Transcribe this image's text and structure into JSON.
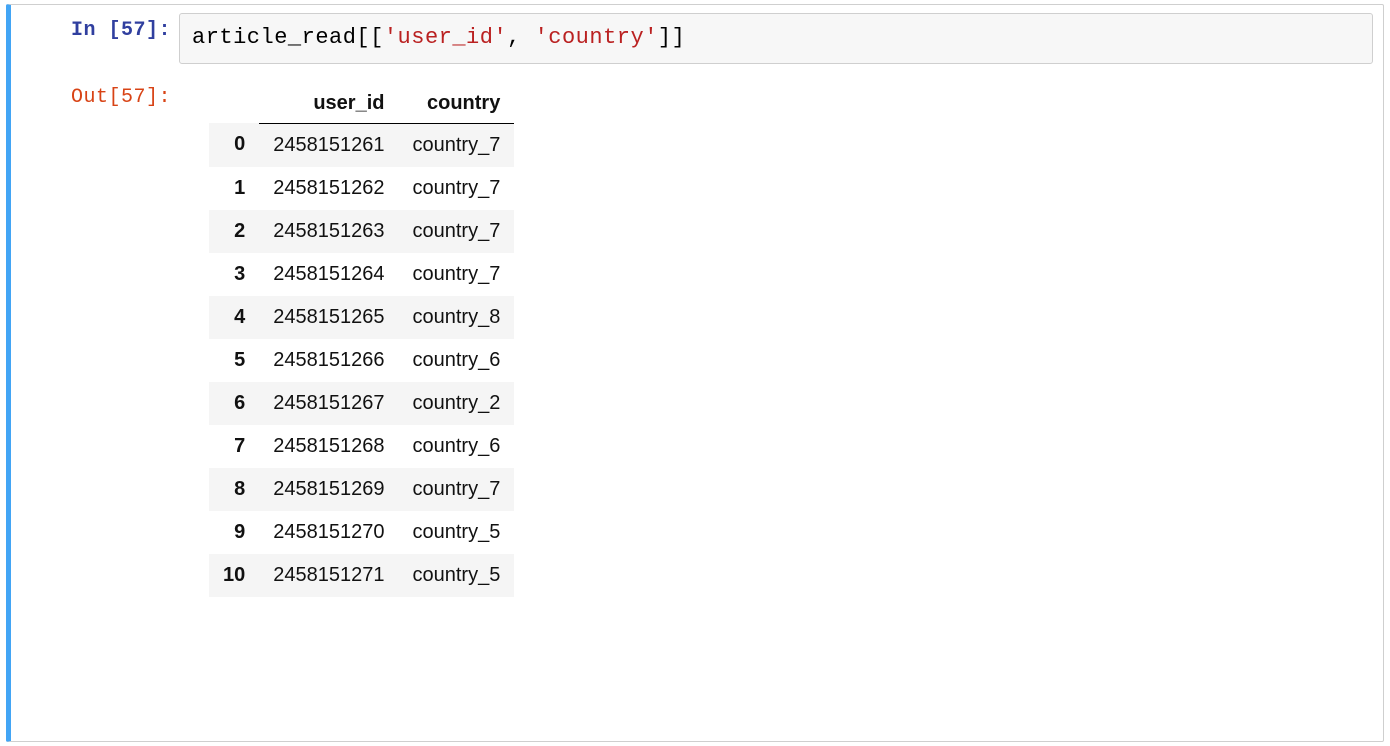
{
  "prompt": {
    "in": "In [57]:",
    "out": "Out[57]:"
  },
  "code": {
    "t1": "article_read[[",
    "s1": "'user_id'",
    "t2": ", ",
    "s2": "'country'",
    "t3": "]]"
  },
  "table": {
    "headers": [
      "",
      "user_id",
      "country"
    ],
    "rows": [
      {
        "idx": "0",
        "user_id": "2458151261",
        "country": "country_7"
      },
      {
        "idx": "1",
        "user_id": "2458151262",
        "country": "country_7"
      },
      {
        "idx": "2",
        "user_id": "2458151263",
        "country": "country_7"
      },
      {
        "idx": "3",
        "user_id": "2458151264",
        "country": "country_7"
      },
      {
        "idx": "4",
        "user_id": "2458151265",
        "country": "country_8"
      },
      {
        "idx": "5",
        "user_id": "2458151266",
        "country": "country_6"
      },
      {
        "idx": "6",
        "user_id": "2458151267",
        "country": "country_2"
      },
      {
        "idx": "7",
        "user_id": "2458151268",
        "country": "country_6"
      },
      {
        "idx": "8",
        "user_id": "2458151269",
        "country": "country_7"
      },
      {
        "idx": "9",
        "user_id": "2458151270",
        "country": "country_5"
      },
      {
        "idx": "10",
        "user_id": "2458151271",
        "country": "country_5"
      }
    ]
  }
}
